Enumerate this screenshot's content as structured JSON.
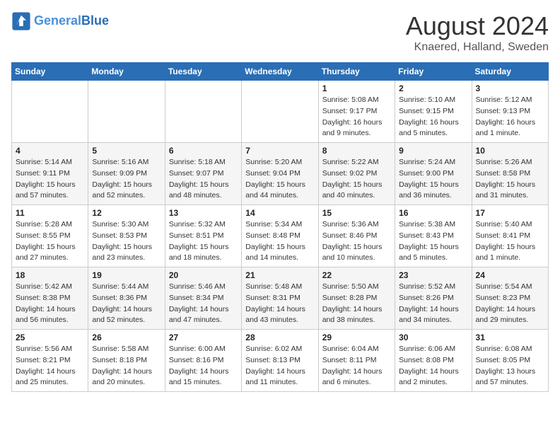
{
  "header": {
    "logo_line1": "General",
    "logo_line2": "Blue",
    "title": "August 2024",
    "subtitle": "Knaered, Halland, Sweden"
  },
  "weekdays": [
    "Sunday",
    "Monday",
    "Tuesday",
    "Wednesday",
    "Thursday",
    "Friday",
    "Saturday"
  ],
  "weeks": [
    [
      {
        "day": "",
        "info": ""
      },
      {
        "day": "",
        "info": ""
      },
      {
        "day": "",
        "info": ""
      },
      {
        "day": "",
        "info": ""
      },
      {
        "day": "1",
        "info": "Sunrise: 5:08 AM\nSunset: 9:17 PM\nDaylight: 16 hours\nand 9 minutes."
      },
      {
        "day": "2",
        "info": "Sunrise: 5:10 AM\nSunset: 9:15 PM\nDaylight: 16 hours\nand 5 minutes."
      },
      {
        "day": "3",
        "info": "Sunrise: 5:12 AM\nSunset: 9:13 PM\nDaylight: 16 hours\nand 1 minute."
      }
    ],
    [
      {
        "day": "4",
        "info": "Sunrise: 5:14 AM\nSunset: 9:11 PM\nDaylight: 15 hours\nand 57 minutes."
      },
      {
        "day": "5",
        "info": "Sunrise: 5:16 AM\nSunset: 9:09 PM\nDaylight: 15 hours\nand 52 minutes."
      },
      {
        "day": "6",
        "info": "Sunrise: 5:18 AM\nSunset: 9:07 PM\nDaylight: 15 hours\nand 48 minutes."
      },
      {
        "day": "7",
        "info": "Sunrise: 5:20 AM\nSunset: 9:04 PM\nDaylight: 15 hours\nand 44 minutes."
      },
      {
        "day": "8",
        "info": "Sunrise: 5:22 AM\nSunset: 9:02 PM\nDaylight: 15 hours\nand 40 minutes."
      },
      {
        "day": "9",
        "info": "Sunrise: 5:24 AM\nSunset: 9:00 PM\nDaylight: 15 hours\nand 36 minutes."
      },
      {
        "day": "10",
        "info": "Sunrise: 5:26 AM\nSunset: 8:58 PM\nDaylight: 15 hours\nand 31 minutes."
      }
    ],
    [
      {
        "day": "11",
        "info": "Sunrise: 5:28 AM\nSunset: 8:55 PM\nDaylight: 15 hours\nand 27 minutes."
      },
      {
        "day": "12",
        "info": "Sunrise: 5:30 AM\nSunset: 8:53 PM\nDaylight: 15 hours\nand 23 minutes."
      },
      {
        "day": "13",
        "info": "Sunrise: 5:32 AM\nSunset: 8:51 PM\nDaylight: 15 hours\nand 18 minutes."
      },
      {
        "day": "14",
        "info": "Sunrise: 5:34 AM\nSunset: 8:48 PM\nDaylight: 15 hours\nand 14 minutes."
      },
      {
        "day": "15",
        "info": "Sunrise: 5:36 AM\nSunset: 8:46 PM\nDaylight: 15 hours\nand 10 minutes."
      },
      {
        "day": "16",
        "info": "Sunrise: 5:38 AM\nSunset: 8:43 PM\nDaylight: 15 hours\nand 5 minutes."
      },
      {
        "day": "17",
        "info": "Sunrise: 5:40 AM\nSunset: 8:41 PM\nDaylight: 15 hours\nand 1 minute."
      }
    ],
    [
      {
        "day": "18",
        "info": "Sunrise: 5:42 AM\nSunset: 8:38 PM\nDaylight: 14 hours\nand 56 minutes."
      },
      {
        "day": "19",
        "info": "Sunrise: 5:44 AM\nSunset: 8:36 PM\nDaylight: 14 hours\nand 52 minutes."
      },
      {
        "day": "20",
        "info": "Sunrise: 5:46 AM\nSunset: 8:34 PM\nDaylight: 14 hours\nand 47 minutes."
      },
      {
        "day": "21",
        "info": "Sunrise: 5:48 AM\nSunset: 8:31 PM\nDaylight: 14 hours\nand 43 minutes."
      },
      {
        "day": "22",
        "info": "Sunrise: 5:50 AM\nSunset: 8:28 PM\nDaylight: 14 hours\nand 38 minutes."
      },
      {
        "day": "23",
        "info": "Sunrise: 5:52 AM\nSunset: 8:26 PM\nDaylight: 14 hours\nand 34 minutes."
      },
      {
        "day": "24",
        "info": "Sunrise: 5:54 AM\nSunset: 8:23 PM\nDaylight: 14 hours\nand 29 minutes."
      }
    ],
    [
      {
        "day": "25",
        "info": "Sunrise: 5:56 AM\nSunset: 8:21 PM\nDaylight: 14 hours\nand 25 minutes."
      },
      {
        "day": "26",
        "info": "Sunrise: 5:58 AM\nSunset: 8:18 PM\nDaylight: 14 hours\nand 20 minutes."
      },
      {
        "day": "27",
        "info": "Sunrise: 6:00 AM\nSunset: 8:16 PM\nDaylight: 14 hours\nand 15 minutes."
      },
      {
        "day": "28",
        "info": "Sunrise: 6:02 AM\nSunset: 8:13 PM\nDaylight: 14 hours\nand 11 minutes."
      },
      {
        "day": "29",
        "info": "Sunrise: 6:04 AM\nSunset: 8:11 PM\nDaylight: 14 hours\nand 6 minutes."
      },
      {
        "day": "30",
        "info": "Sunrise: 6:06 AM\nSunset: 8:08 PM\nDaylight: 14 hours\nand 2 minutes."
      },
      {
        "day": "31",
        "info": "Sunrise: 6:08 AM\nSunset: 8:05 PM\nDaylight: 13 hours\nand 57 minutes."
      }
    ]
  ]
}
